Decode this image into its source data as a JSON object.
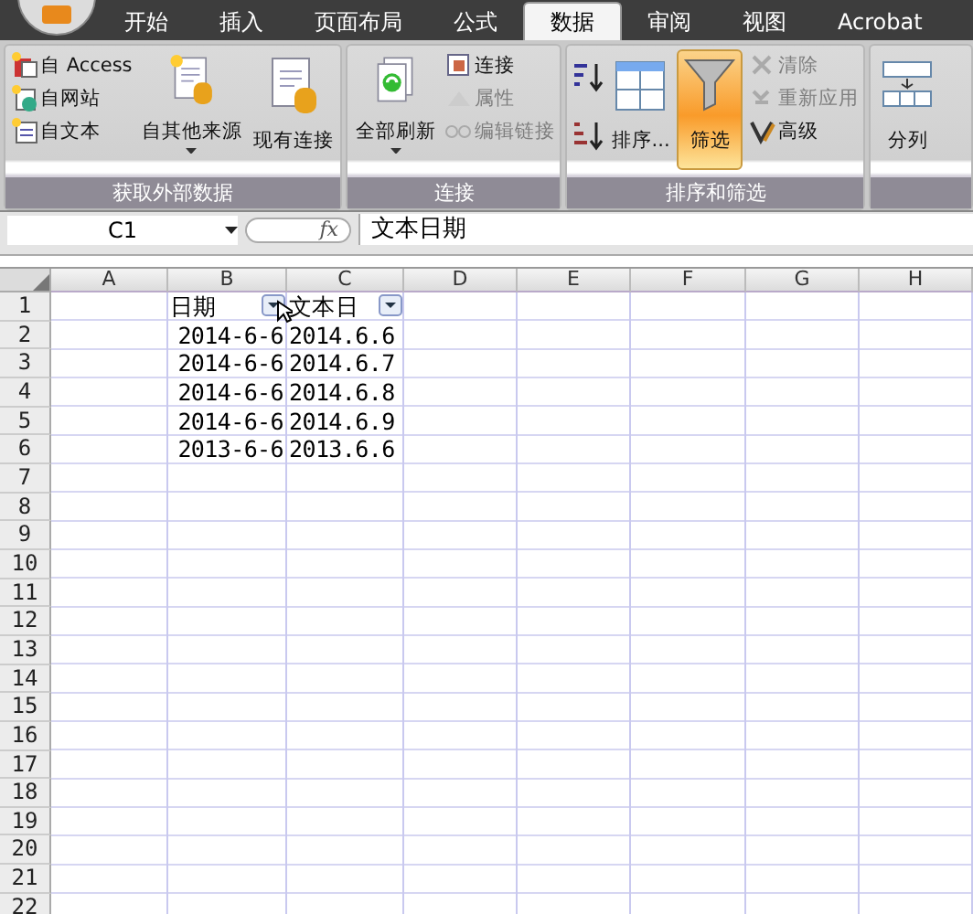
{
  "tabs": [
    {
      "label": "开始",
      "selected": false
    },
    {
      "label": "插入",
      "selected": false
    },
    {
      "label": "页面布局",
      "selected": false
    },
    {
      "label": "公式",
      "selected": false
    },
    {
      "label": "数据",
      "selected": true
    },
    {
      "label": "审阅",
      "selected": false
    },
    {
      "label": "视图",
      "selected": false
    },
    {
      "label": "Acrobat",
      "selected": false
    }
  ],
  "ribbon": {
    "groups": [
      {
        "label": "获取外部数据",
        "columns": [
          {
            "kind": "stack",
            "items": [
              {
                "label": "自 Access",
                "disabled": false
              },
              {
                "label": "自网站",
                "disabled": false
              },
              {
                "label": "自文本",
                "disabled": false
              }
            ]
          },
          {
            "kind": "large",
            "label": "自其他来源",
            "dropdown": true,
            "on": false
          },
          {
            "kind": "large",
            "label": "现有连接",
            "dropdown": false,
            "on": false
          }
        ]
      },
      {
        "label": "连接",
        "columns": [
          {
            "kind": "large",
            "label": "全部刷新",
            "dropdown": true,
            "on": false
          },
          {
            "kind": "stack",
            "items": [
              {
                "label": "连接",
                "disabled": false
              },
              {
                "label": "属性",
                "disabled": true
              },
              {
                "label": "编辑链接",
                "disabled": true
              }
            ]
          }
        ]
      },
      {
        "label": "排序和筛选",
        "columns": [
          {
            "kind": "sort"
          },
          {
            "kind": "large",
            "label": "排序...",
            "dropdown": false,
            "on": false
          },
          {
            "kind": "large",
            "label": "筛选",
            "dropdown": false,
            "on": true
          },
          {
            "kind": "stack",
            "items": [
              {
                "label": "清除",
                "disabled": true
              },
              {
                "label": "重新应用",
                "disabled": true
              },
              {
                "label": "高级",
                "disabled": false
              }
            ]
          }
        ]
      },
      {
        "columns": [
          {
            "kind": "large",
            "label": "分列",
            "dropdown": false,
            "on": false
          }
        ]
      }
    ]
  },
  "formula_bar": {
    "name_box": "C1",
    "function_symbol": "fx",
    "value": "文本日期"
  },
  "sheet": {
    "columns": [
      "A",
      "B",
      "C",
      "D",
      "E",
      "F",
      "G",
      "H"
    ],
    "rows": [
      {
        "number": "1",
        "cells": [
          null,
          {
            "text": "日期",
            "kind": "text",
            "filter": true
          },
          {
            "text": "文本日",
            "kind": "text",
            "filter": true
          },
          null,
          null,
          null,
          null,
          null
        ]
      },
      {
        "number": "2",
        "cells": [
          null,
          {
            "text": "2014-6-6",
            "kind": "date",
            "filter": false
          },
          {
            "text": "2014.6.6",
            "kind": "text",
            "filter": false
          },
          null,
          null,
          null,
          null,
          null
        ]
      },
      {
        "number": "3",
        "cells": [
          null,
          {
            "text": "2014-6-6",
            "kind": "date",
            "filter": false
          },
          {
            "text": "2014.6.7",
            "kind": "text",
            "filter": false
          },
          null,
          null,
          null,
          null,
          null
        ]
      },
      {
        "number": "4",
        "cells": [
          null,
          {
            "text": "2014-6-6",
            "kind": "date",
            "filter": false
          },
          {
            "text": "2014.6.8",
            "kind": "text",
            "filter": false
          },
          null,
          null,
          null,
          null,
          null
        ]
      },
      {
        "number": "5",
        "cells": [
          null,
          {
            "text": "2014-6-6",
            "kind": "date",
            "filter": false
          },
          {
            "text": "2014.6.9",
            "kind": "text",
            "filter": false
          },
          null,
          null,
          null,
          null,
          null
        ]
      },
      {
        "number": "6",
        "cells": [
          null,
          {
            "text": "2013-6-6",
            "kind": "date",
            "filter": false
          },
          {
            "text": "2013.6.6",
            "kind": "text",
            "filter": false
          },
          null,
          null,
          null,
          null,
          null
        ]
      },
      {
        "number": "7"
      },
      {
        "number": "8"
      },
      {
        "number": "9"
      },
      {
        "number": "10"
      },
      {
        "number": "11"
      },
      {
        "number": "12"
      },
      {
        "number": "13"
      },
      {
        "number": "14"
      },
      {
        "number": "15"
      },
      {
        "number": "16"
      },
      {
        "number": "17"
      },
      {
        "number": "18"
      },
      {
        "number": "19"
      },
      {
        "number": "20"
      },
      {
        "number": "21"
      },
      {
        "number": "22"
      }
    ]
  }
}
